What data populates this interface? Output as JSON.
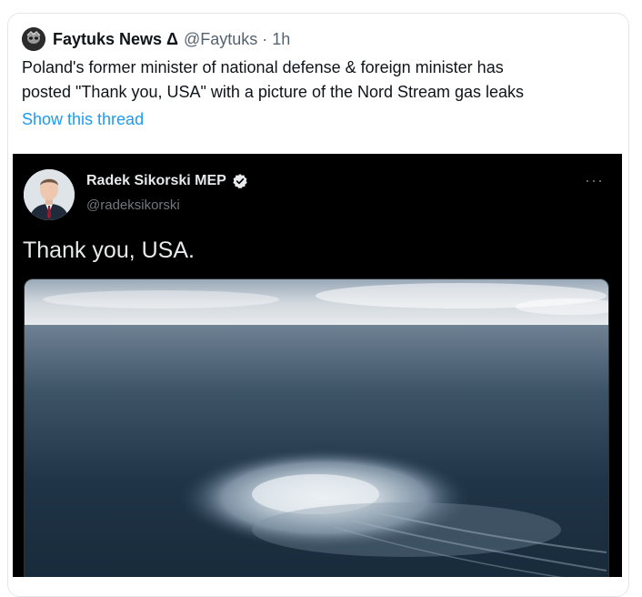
{
  "tweet": {
    "author_name": "Faytuks News Δ",
    "author_handle": "@Faytuks",
    "separator": "·",
    "time": "1h",
    "text_lines": [
      "Poland's former minister of national defense & foreign minister has",
      "posted \"Thank you, USA\" with a picture of the Nord Stream gas leaks"
    ],
    "show_thread": "Show this thread"
  },
  "embedded": {
    "author_name": "Radek Sikorski MEP",
    "author_handle": "@radeksikorski",
    "more_glyph": "···",
    "text": "Thank you, USA.",
    "photo_icon": "sea-photo"
  },
  "colors": {
    "accent": "#1d9bf0",
    "text_primary": "#0f1419",
    "text_secondary": "#536471",
    "embed_bg": "#000000"
  }
}
